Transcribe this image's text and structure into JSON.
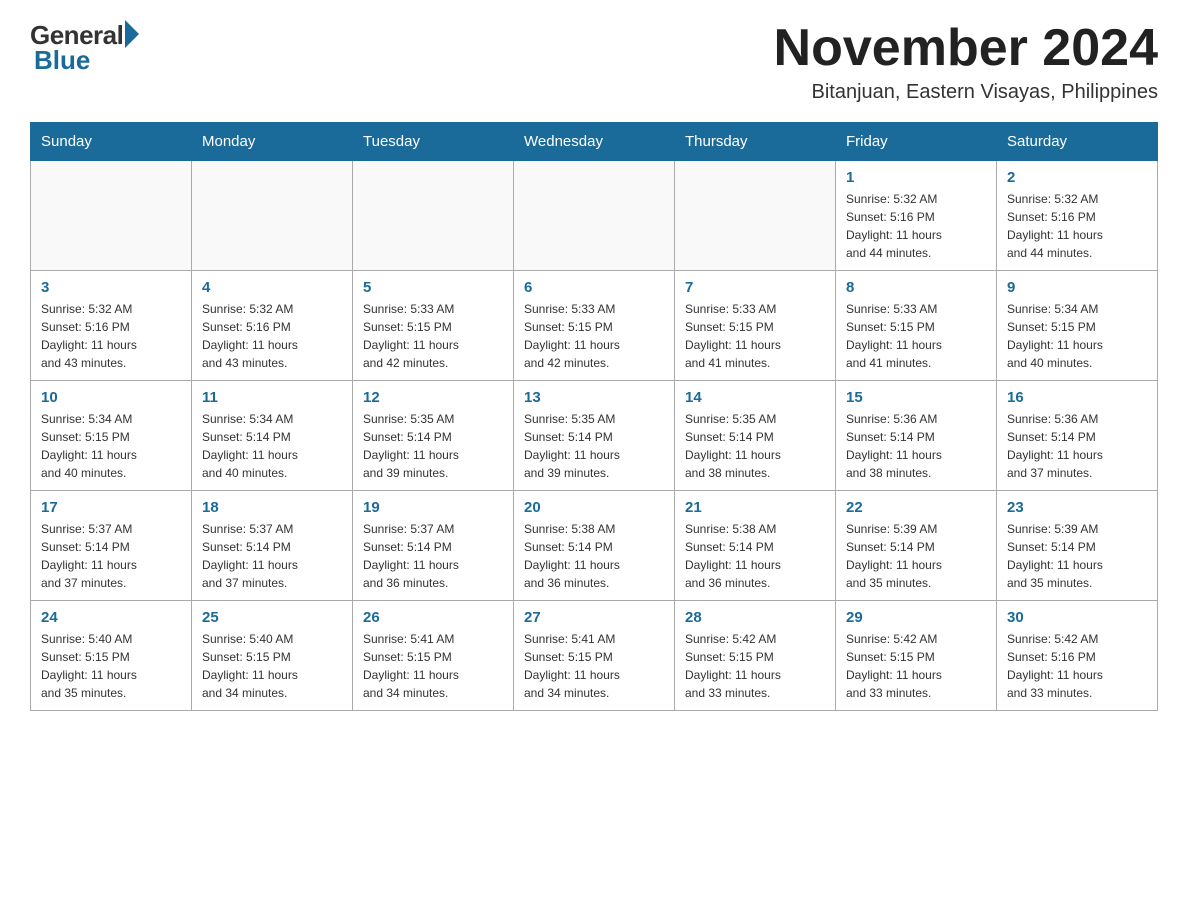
{
  "header": {
    "logo": {
      "general": "General",
      "blue": "Blue"
    },
    "month": "November 2024",
    "location": "Bitanjuan, Eastern Visayas, Philippines"
  },
  "days_of_week": [
    "Sunday",
    "Monday",
    "Tuesday",
    "Wednesday",
    "Thursday",
    "Friday",
    "Saturday"
  ],
  "weeks": [
    {
      "days": [
        {
          "num": "",
          "info": ""
        },
        {
          "num": "",
          "info": ""
        },
        {
          "num": "",
          "info": ""
        },
        {
          "num": "",
          "info": ""
        },
        {
          "num": "",
          "info": ""
        },
        {
          "num": "1",
          "info": "Sunrise: 5:32 AM\nSunset: 5:16 PM\nDaylight: 11 hours\nand 44 minutes."
        },
        {
          "num": "2",
          "info": "Sunrise: 5:32 AM\nSunset: 5:16 PM\nDaylight: 11 hours\nand 44 minutes."
        }
      ]
    },
    {
      "days": [
        {
          "num": "3",
          "info": "Sunrise: 5:32 AM\nSunset: 5:16 PM\nDaylight: 11 hours\nand 43 minutes."
        },
        {
          "num": "4",
          "info": "Sunrise: 5:32 AM\nSunset: 5:16 PM\nDaylight: 11 hours\nand 43 minutes."
        },
        {
          "num": "5",
          "info": "Sunrise: 5:33 AM\nSunset: 5:15 PM\nDaylight: 11 hours\nand 42 minutes."
        },
        {
          "num": "6",
          "info": "Sunrise: 5:33 AM\nSunset: 5:15 PM\nDaylight: 11 hours\nand 42 minutes."
        },
        {
          "num": "7",
          "info": "Sunrise: 5:33 AM\nSunset: 5:15 PM\nDaylight: 11 hours\nand 41 minutes."
        },
        {
          "num": "8",
          "info": "Sunrise: 5:33 AM\nSunset: 5:15 PM\nDaylight: 11 hours\nand 41 minutes."
        },
        {
          "num": "9",
          "info": "Sunrise: 5:34 AM\nSunset: 5:15 PM\nDaylight: 11 hours\nand 40 minutes."
        }
      ]
    },
    {
      "days": [
        {
          "num": "10",
          "info": "Sunrise: 5:34 AM\nSunset: 5:15 PM\nDaylight: 11 hours\nand 40 minutes."
        },
        {
          "num": "11",
          "info": "Sunrise: 5:34 AM\nSunset: 5:14 PM\nDaylight: 11 hours\nand 40 minutes."
        },
        {
          "num": "12",
          "info": "Sunrise: 5:35 AM\nSunset: 5:14 PM\nDaylight: 11 hours\nand 39 minutes."
        },
        {
          "num": "13",
          "info": "Sunrise: 5:35 AM\nSunset: 5:14 PM\nDaylight: 11 hours\nand 39 minutes."
        },
        {
          "num": "14",
          "info": "Sunrise: 5:35 AM\nSunset: 5:14 PM\nDaylight: 11 hours\nand 38 minutes."
        },
        {
          "num": "15",
          "info": "Sunrise: 5:36 AM\nSunset: 5:14 PM\nDaylight: 11 hours\nand 38 minutes."
        },
        {
          "num": "16",
          "info": "Sunrise: 5:36 AM\nSunset: 5:14 PM\nDaylight: 11 hours\nand 37 minutes."
        }
      ]
    },
    {
      "days": [
        {
          "num": "17",
          "info": "Sunrise: 5:37 AM\nSunset: 5:14 PM\nDaylight: 11 hours\nand 37 minutes."
        },
        {
          "num": "18",
          "info": "Sunrise: 5:37 AM\nSunset: 5:14 PM\nDaylight: 11 hours\nand 37 minutes."
        },
        {
          "num": "19",
          "info": "Sunrise: 5:37 AM\nSunset: 5:14 PM\nDaylight: 11 hours\nand 36 minutes."
        },
        {
          "num": "20",
          "info": "Sunrise: 5:38 AM\nSunset: 5:14 PM\nDaylight: 11 hours\nand 36 minutes."
        },
        {
          "num": "21",
          "info": "Sunrise: 5:38 AM\nSunset: 5:14 PM\nDaylight: 11 hours\nand 36 minutes."
        },
        {
          "num": "22",
          "info": "Sunrise: 5:39 AM\nSunset: 5:14 PM\nDaylight: 11 hours\nand 35 minutes."
        },
        {
          "num": "23",
          "info": "Sunrise: 5:39 AM\nSunset: 5:14 PM\nDaylight: 11 hours\nand 35 minutes."
        }
      ]
    },
    {
      "days": [
        {
          "num": "24",
          "info": "Sunrise: 5:40 AM\nSunset: 5:15 PM\nDaylight: 11 hours\nand 35 minutes."
        },
        {
          "num": "25",
          "info": "Sunrise: 5:40 AM\nSunset: 5:15 PM\nDaylight: 11 hours\nand 34 minutes."
        },
        {
          "num": "26",
          "info": "Sunrise: 5:41 AM\nSunset: 5:15 PM\nDaylight: 11 hours\nand 34 minutes."
        },
        {
          "num": "27",
          "info": "Sunrise: 5:41 AM\nSunset: 5:15 PM\nDaylight: 11 hours\nand 34 minutes."
        },
        {
          "num": "28",
          "info": "Sunrise: 5:42 AM\nSunset: 5:15 PM\nDaylight: 11 hours\nand 33 minutes."
        },
        {
          "num": "29",
          "info": "Sunrise: 5:42 AM\nSunset: 5:15 PM\nDaylight: 11 hours\nand 33 minutes."
        },
        {
          "num": "30",
          "info": "Sunrise: 5:42 AM\nSunset: 5:16 PM\nDaylight: 11 hours\nand 33 minutes."
        }
      ]
    }
  ]
}
